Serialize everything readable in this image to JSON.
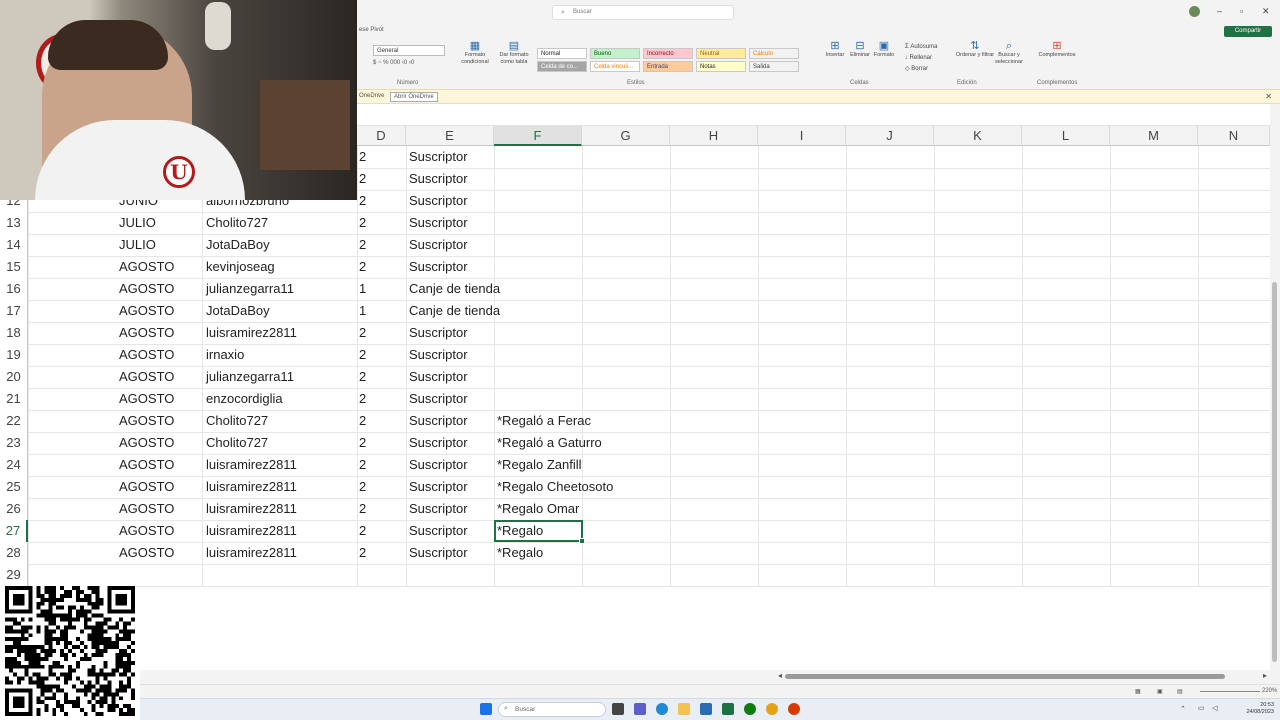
{
  "ribbon": {
    "search_placeholder": "Buscar",
    "share_label": "Compartir",
    "pivot_label": "ese Pivot",
    "number_format": "General",
    "groups": {
      "number": "Número",
      "styles": "Estilos",
      "cells": "Celdas",
      "editing": "Edición",
      "addins": "Complementos"
    },
    "buttons": {
      "conditional_format": "Formato condicional",
      "table_format": "Dar formato como tabla",
      "insert": "Insertar",
      "delete": "Eliminar",
      "format": "Formato",
      "sort_filter": "Ordenar y filtrar",
      "find_select": "Buscar y seleccionar",
      "addins": "Complementos",
      "autosum": "Autosuma",
      "fill": "Rellenar",
      "clear": "Borrar"
    },
    "styles": [
      {
        "label": "Normal",
        "bg": "#ffffff",
        "fg": "#222222"
      },
      {
        "label": "Bueno",
        "bg": "#c6efce",
        "fg": "#006100"
      },
      {
        "label": "Incorrecto",
        "bg": "#ffc7ce",
        "fg": "#9c0006"
      },
      {
        "label": "Neutral",
        "bg": "#ffeb9c",
        "fg": "#9c6500"
      },
      {
        "label": "Cálculo",
        "bg": "#f2f2f2",
        "fg": "#fa7d00"
      },
      {
        "label": "Celda de co...",
        "bg": "#a5a5a5",
        "fg": "#ffffff"
      },
      {
        "label": "Celda vinculi...",
        "bg": "#ffffff",
        "fg": "#fa7d00"
      },
      {
        "label": "Entrada",
        "bg": "#ffcc99",
        "fg": "#3f3f76"
      },
      {
        "label": "Notas",
        "bg": "#ffffcc",
        "fg": "#222222"
      },
      {
        "label": "Salida",
        "bg": "#f2f2f2",
        "fg": "#3f3f3f"
      }
    ]
  },
  "notification": {
    "onedrive": "OneDrive",
    "button": "Abrir OneDrive"
  },
  "columns": [
    "D",
    "E",
    "F",
    "G",
    "H",
    "I",
    "J",
    "K",
    "L",
    "M",
    "N"
  ],
  "selected_column": "F",
  "rows": [
    {
      "n": "",
      "month": "",
      "user": "",
      "qty": "2",
      "type": "Suscriptor",
      "note": ""
    },
    {
      "n": "",
      "month": "",
      "user": "",
      "qty": "2",
      "type": "Suscriptor",
      "note": ""
    },
    {
      "n": "12",
      "month": "JUNIO",
      "user": "albornozbruno",
      "qty": "2",
      "type": "Suscriptor",
      "note": ""
    },
    {
      "n": "13",
      "month": "JULIO",
      "user": "Cholito727",
      "qty": "2",
      "type": "Suscriptor",
      "note": ""
    },
    {
      "n": "14",
      "month": "JULIO",
      "user": "JotaDaBoy",
      "qty": "2",
      "type": "Suscriptor",
      "note": ""
    },
    {
      "n": "15",
      "month": "AGOSTO",
      "user": "kevinjoseag",
      "qty": "2",
      "type": "Suscriptor",
      "note": ""
    },
    {
      "n": "16",
      "month": "AGOSTO",
      "user": "julianzegarra11",
      "qty": "1",
      "type": "Canje de tienda",
      "note": ""
    },
    {
      "n": "17",
      "month": "AGOSTO",
      "user": "JotaDaBoy",
      "qty": "1",
      "type": "Canje de tienda",
      "note": ""
    },
    {
      "n": "18",
      "month": "AGOSTO",
      "user": "luisramirez2811",
      "qty": "2",
      "type": "Suscriptor",
      "note": ""
    },
    {
      "n": "19",
      "month": "AGOSTO",
      "user": "irnaxio",
      "qty": "2",
      "type": "Suscriptor",
      "note": ""
    },
    {
      "n": "20",
      "month": "AGOSTO",
      "user": "julianzegarra11",
      "qty": "2",
      "type": "Suscriptor",
      "note": ""
    },
    {
      "n": "21",
      "month": "AGOSTO",
      "user": "enzocordiglia",
      "qty": "2",
      "type": "Suscriptor",
      "note": ""
    },
    {
      "n": "22",
      "month": "AGOSTO",
      "user": "Cholito727",
      "qty": "2",
      "type": "Suscriptor",
      "note": "*Regaló a Ferac"
    },
    {
      "n": "23",
      "month": "AGOSTO",
      "user": "Cholito727",
      "qty": "2",
      "type": "Suscriptor",
      "note": "*Regaló a Gaturro"
    },
    {
      "n": "24",
      "month": "AGOSTO",
      "user": "luisramirez2811",
      "qty": "2",
      "type": "Suscriptor",
      "note": "*Regalo Zanfill"
    },
    {
      "n": "25",
      "month": "AGOSTO",
      "user": "luisramirez2811",
      "qty": "2",
      "type": "Suscriptor",
      "note": "*Regalo Cheetosoto"
    },
    {
      "n": "26",
      "month": "AGOSTO",
      "user": "luisramirez2811",
      "qty": "2",
      "type": "Suscriptor",
      "note": "*Regalo Omar"
    },
    {
      "n": "27",
      "month": "AGOSTO",
      "user": "luisramirez2811",
      "qty": "2",
      "type": "Suscriptor",
      "note": "*Regalo"
    },
    {
      "n": "28",
      "month": "AGOSTO",
      "user": "luisramirez2811",
      "qty": "2",
      "type": "Suscriptor",
      "note": "*Regalo"
    },
    {
      "n": "29",
      "month": "",
      "user": "",
      "qty": "",
      "type": "",
      "note": ""
    }
  ],
  "taskbar": {
    "search_placeholder": "Buscar",
    "time": "20:53",
    "date": "24/08/2023"
  },
  "status": {
    "zoom": "220%"
  }
}
